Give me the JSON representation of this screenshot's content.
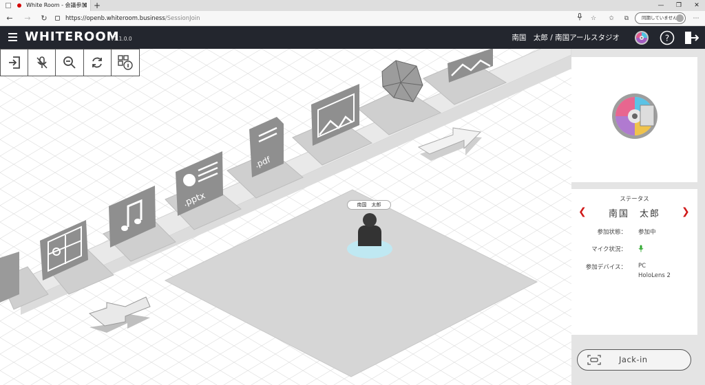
{
  "browser": {
    "tab_title": "White Room - 会議参加",
    "tab_close": "×",
    "new_tab": "+",
    "url_host": "https://openb.whiteroom.business",
    "url_path": "/SessionJoin",
    "sync_label": "同期していません",
    "window_controls": [
      "—",
      "❐",
      "✕"
    ]
  },
  "app": {
    "logo": "WHITEROOM",
    "version": "v1.1.0.0",
    "user": "南国　太郎 / 南国アールスタジオ"
  },
  "toolbar": {
    "icons": [
      "exit-icon",
      "mic-off-icon",
      "zoom-out-icon",
      "refresh-icon",
      "qr-info-icon"
    ]
  },
  "workspace": {
    "avatar_label": "南国　太郎",
    "file_labels": [
      ".pptx",
      ".pdf"
    ]
  },
  "status": {
    "title": "ステータス",
    "name": "南国　太郎",
    "rows": [
      {
        "label": "参加状態：",
        "value": "参加中"
      },
      {
        "label": "マイク状況：",
        "value": ""
      },
      {
        "label": "参加デバイス：",
        "value": "PC"
      }
    ],
    "device_2": "HoloLens 2"
  },
  "jackin": {
    "label": "Jack-in"
  },
  "colors": {
    "header_bg": "#23262e",
    "accent_red": "#d01818",
    "mic_green": "#2fa82f",
    "avatar_base": "#bfe8f2"
  }
}
